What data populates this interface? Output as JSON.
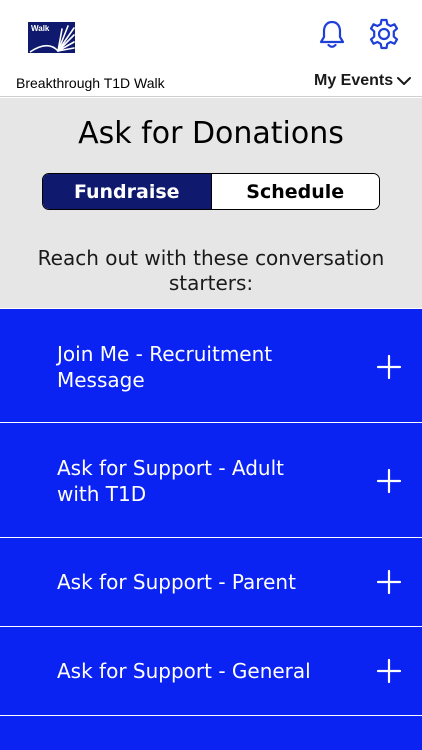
{
  "header": {
    "logo_text": "Walk",
    "org_name": "Breakthrough T1D Walk",
    "events_label": "My Events",
    "icons": [
      "bell-icon",
      "gear-icon",
      "chevron-down-icon"
    ]
  },
  "page": {
    "title": "Ask for Donations",
    "tabs": [
      {
        "label": "Fundraise",
        "active": true
      },
      {
        "label": "Schedule",
        "active": false
      }
    ],
    "intro": "Reach out with these conversation starters:"
  },
  "starters": [
    {
      "label": "Join Me - Recruitment Message"
    },
    {
      "label": "Ask for Support - Adult with T1D"
    },
    {
      "label": "Ask for Support - Parent"
    },
    {
      "label": "Ask for Support - General"
    }
  ],
  "colors": {
    "navy": "#0f1a6e",
    "accent_blue": "#0a22f2",
    "icon_blue": "#1e3fd8",
    "background_gray": "#e6e6e6"
  }
}
